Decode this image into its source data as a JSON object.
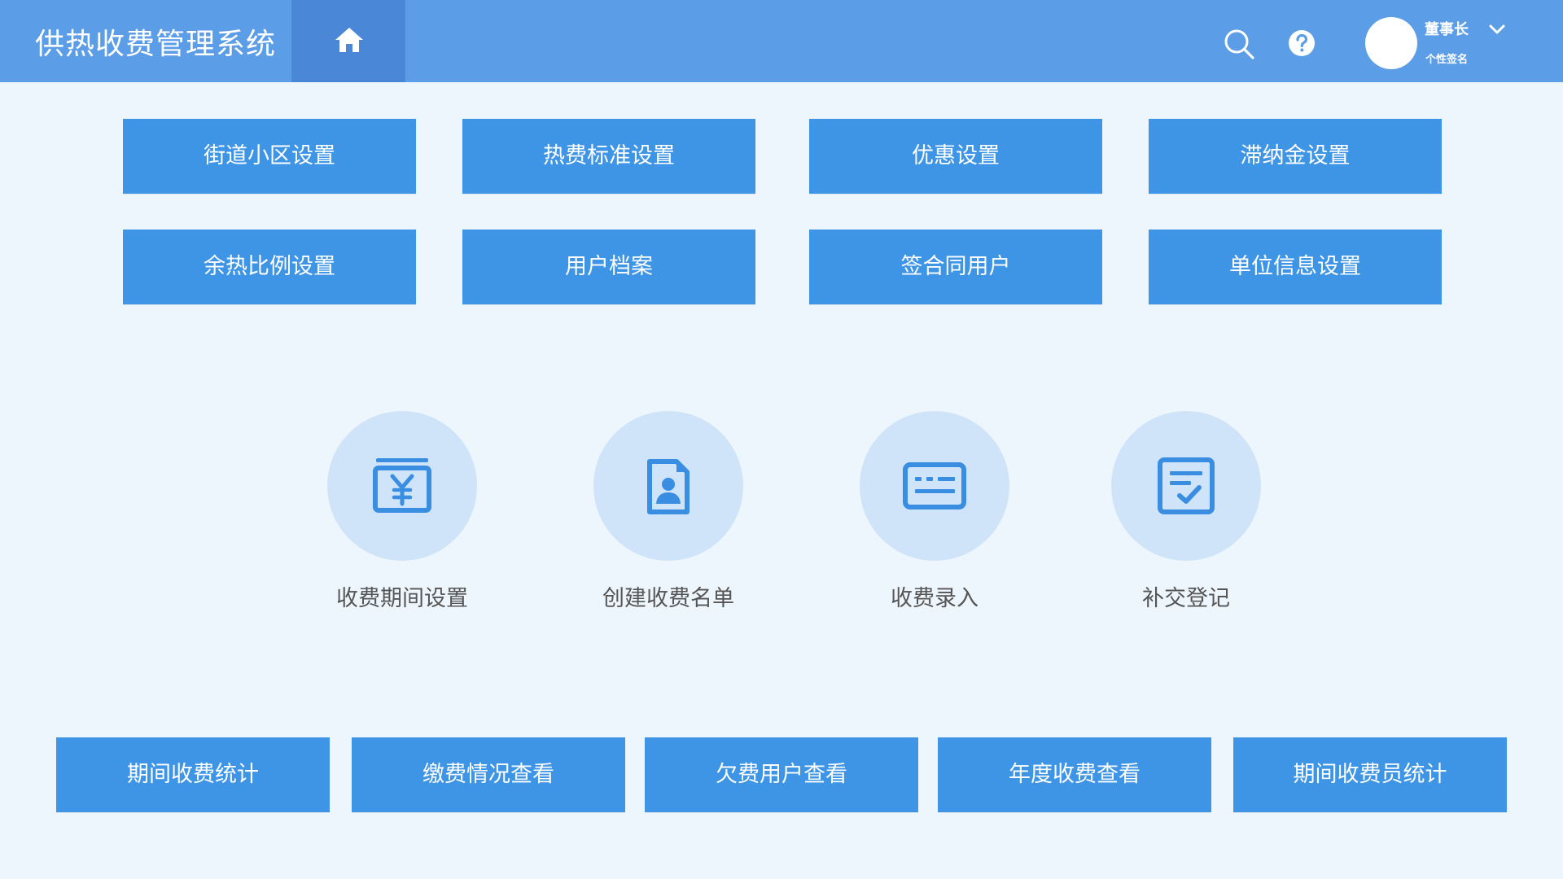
{
  "header": {
    "title": "供热收费管理系统",
    "user_name": "董事长",
    "user_signature": "个性签名"
  },
  "icons": {
    "home": "home-icon",
    "search": "search-icon",
    "help": "help-circle-icon",
    "chevron": "chevron-down-icon",
    "fee_period": "yuan-box-icon",
    "create_list": "contact-file-icon",
    "entry": "keyboard-icon",
    "makeup": "checklist-icon"
  },
  "settings": {
    "row1": [
      "街道小区设置",
      "热费标准设置",
      "优惠设置",
      "滞纳金设置"
    ],
    "row2": [
      "余热比例设置",
      "用户档案",
      "签合同用户",
      "单位信息设置"
    ]
  },
  "quick_actions": [
    "收费期间设置",
    "创建收费名单",
    "收费录入",
    "补交登记"
  ],
  "reports": [
    "期间收费统计",
    "缴费情况查看",
    "欠费用户查看",
    "年度收费查看",
    "期间收费员统计"
  ],
  "colors": {
    "header": "#5b9de6",
    "header_active_tab": "#4a87d6",
    "tile": "#3f95e5",
    "circle": "#cfe4f8",
    "icon": "#3a8ee2",
    "background": "#eef6fd"
  }
}
